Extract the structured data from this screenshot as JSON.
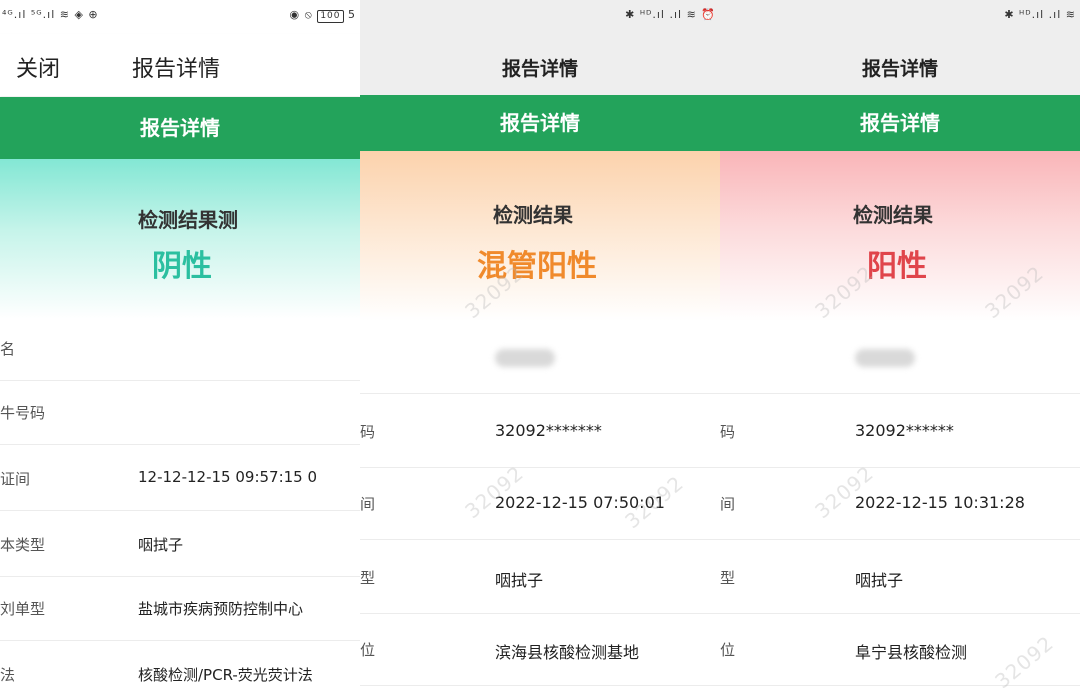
{
  "panels": [
    {
      "status": {
        "left": "⁴ᴳ.ıl ⁵ᴳ.ıl ≋ ◈ ⊕",
        "right_icons": "◉ ⦸",
        "battery": "100",
        "extra": "5"
      },
      "nav": {
        "close_label": "关闭",
        "title": "报告详情"
      },
      "green_bar": "报告详情",
      "result": {
        "label": "检测结果测",
        "value": "阴性"
      },
      "rows": [
        {
          "label": "名",
          "value": ""
        },
        {
          "label": "牛号码",
          "value": ""
        },
        {
          "label": "证间",
          "value": "12-12-12-15 09:57:15 0"
        },
        {
          "label": "本类型",
          "value": "咽拭子"
        },
        {
          "label": "刘单型",
          "value": "盐城市疾病预防控制中心"
        },
        {
          "label": "法",
          "value": "核酸检测/PCR-荧光荧计法"
        }
      ]
    },
    {
      "status": {
        "right_icons": "✱ ᴴᴰ.ıl .ıl ≋ ⏰"
      },
      "nav": {
        "title": "报告详情"
      },
      "green_bar": "报告详情",
      "result": {
        "label": "检测结果",
        "value": "混管阳性"
      },
      "watermark": "32092",
      "rows": [
        {
          "label": "",
          "value": ""
        },
        {
          "label": "码",
          "value": "32092*******"
        },
        {
          "label": "间",
          "value": "2022-12-15 07:50:01"
        },
        {
          "label": "型",
          "value": "咽拭子"
        },
        {
          "label": "位",
          "value": "滨海县核酸检测基地"
        }
      ]
    },
    {
      "status": {
        "right_icons": "✱ ᴴᴰ.ıl .ıl ≋"
      },
      "nav": {
        "title": "报告详情"
      },
      "green_bar": "报告详情",
      "result": {
        "label": "检测结果",
        "value": "阳性"
      },
      "watermark": "32092",
      "rows": [
        {
          "label": "",
          "value": ""
        },
        {
          "label": "码",
          "value": "32092******"
        },
        {
          "label": "间",
          "value": "2022-12-15 10:31:28"
        },
        {
          "label": "型",
          "value": "咽拭子"
        },
        {
          "label": "位",
          "value": "阜宁县核酸检测"
        }
      ]
    }
  ],
  "colors": {
    "green": "#23a35b",
    "negative": "#2bbfa0",
    "mixed_positive": "#f08a2c",
    "positive": "#e0454b"
  }
}
